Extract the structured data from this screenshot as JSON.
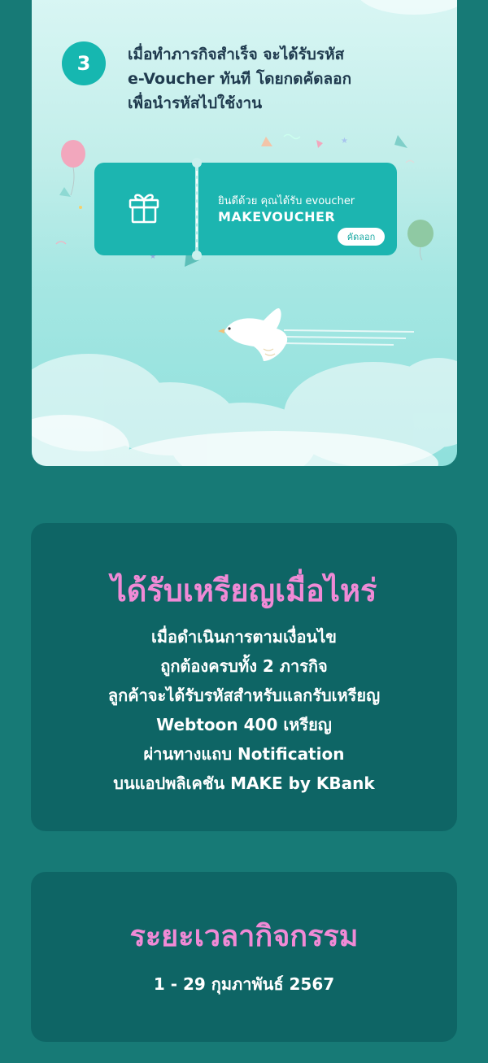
{
  "step": {
    "number": "3",
    "lines": [
      "เมื่อทำภารกิจสำเร็จ จะได้รับรหัส",
      "e-Voucher ทันที โดยกดคัดลอก",
      "เพื่อนำรหัสไปใช้งาน"
    ]
  },
  "voucher": {
    "message": "ยินดีด้วย คุณได้รับ evoucher",
    "code": "MAKEVOUCHER",
    "copy_label": "คัดลอก",
    "icon": "gift-icon"
  },
  "reward": {
    "heading": "ได้รับเหรียญเมื่อไหร่",
    "lines": [
      "เมื่อดำเนินการตามเงื่อนไข",
      "ถูกต้องครบทั้ง 2 ภารกิจ",
      "ลูกค้าจะได้รับรหัสสำหรับแลกรับเหรียญ",
      "Webtoon 400 เหรียญ",
      "ผ่านทางแถบ Notification",
      "บนแอปพลิเคชัน MAKE by KBank"
    ]
  },
  "period": {
    "heading": "ระยะเวลากิจกรรม",
    "dates": "1 - 29 กุมภาพันธ์ 2567"
  },
  "colors": {
    "page_bg": "#177a76",
    "card_bg": "#0e6565",
    "heading_pink": "#f08ad6",
    "voucher_teal": "#1cb5b0"
  }
}
